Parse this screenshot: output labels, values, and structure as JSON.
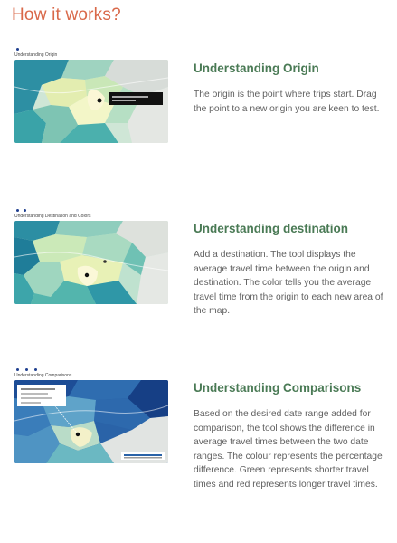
{
  "page": {
    "title": "How it works?"
  },
  "sections": [
    {
      "caption": "Understanding Origin",
      "tooltip": "",
      "title": "Understanding Origin",
      "description": "The origin is the point where trips start. Drag the point to a new origin you are keen to test."
    },
    {
      "caption": "Understanding Destination and Colors",
      "tooltip": "",
      "title": "Understanding destination",
      "description": "Add a destination. The tool displays the average travel time between the origin and destination. The color tells you the average travel time from the origin to each new area of the map."
    },
    {
      "caption": "Understanding Comparisons",
      "tooltip": "",
      "title": "Understanding Comparisons",
      "description": "Based on the desired date range added for comparison, the tool shows the difference in average travel times between the two date ranges. The colour represents the percentage difference. Green represents shorter travel times and red represents longer travel times."
    }
  ],
  "colors": {
    "title_accent": "#d9694a",
    "section_heading": "#4a7a55",
    "body_text": "#606060",
    "step_dots": "#1f3f8f"
  }
}
